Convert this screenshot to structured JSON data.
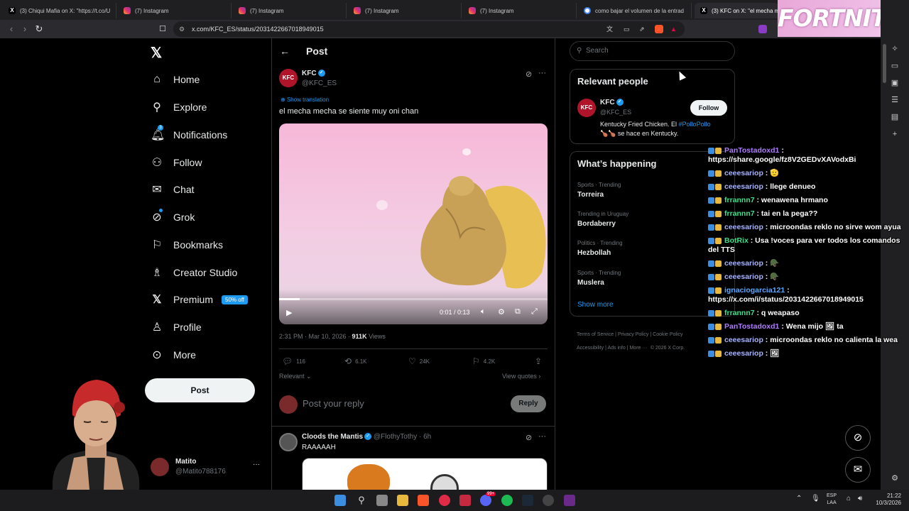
{
  "browser": {
    "tabs": [
      {
        "title": "(3) Chiqui Mafia on X: \"https://t.co/U",
        "icon": "x-icon"
      },
      {
        "title": "(7) Instagram",
        "icon": "instagram-icon"
      },
      {
        "title": "(7) Instagram",
        "icon": "instagram-icon"
      },
      {
        "title": "(7) Instagram",
        "icon": "instagram-icon"
      },
      {
        "title": "(7) Instagram",
        "icon": "instagram-icon"
      },
      {
        "title": "como bajar el volumen de la entrad",
        "icon": "google-icon"
      },
      {
        "title": "(3) KFC on X: \"el mecha m",
        "icon": "x-icon"
      }
    ],
    "url": "x.com/KFC_ES/status/2031422667018949015",
    "overlay_banner": "FORTNITE"
  },
  "sidebar": {
    "items": [
      {
        "label": "Home",
        "icon": "home-icon"
      },
      {
        "label": "Explore",
        "icon": "search-icon"
      },
      {
        "label": "Notifications",
        "icon": "bell-icon",
        "badge": "3"
      },
      {
        "label": "Follow",
        "icon": "add-person-icon"
      },
      {
        "label": "Chat",
        "icon": "mail-icon"
      },
      {
        "label": "Grok",
        "icon": "grok-icon"
      },
      {
        "label": "Bookmarks",
        "icon": "bookmark-icon"
      },
      {
        "label": "Creator Studio",
        "icon": "creator-icon"
      },
      {
        "label": "Premium",
        "icon": "x-icon",
        "badge": "50% off"
      },
      {
        "label": "Profile",
        "icon": "person-icon"
      },
      {
        "label": "More",
        "icon": "more-icon"
      }
    ],
    "post_button": "Post",
    "account": {
      "name": "Matito",
      "handle": "@Matito788176"
    }
  },
  "post": {
    "header": "Post",
    "author": {
      "name": "KFC",
      "handle": "@KFC_ES"
    },
    "show_translation": "Show translation",
    "text": "el mecha mecha se siente muy oni chan",
    "video": {
      "time": "0:01 / 0:13",
      "progress": 0.077
    },
    "meta": {
      "time": "2:31 PM · Mar 10, 2026 · ",
      "views_count": "911K",
      "views_label": " Views"
    },
    "stats": {
      "replies": "116",
      "reposts": "6.1K",
      "likes": "24K",
      "bookmarks": "4.2K"
    },
    "relevant": "Relevant",
    "view_quotes": "View quotes",
    "reply_placeholder": "Post your reply",
    "reply_button": "Reply"
  },
  "reply": {
    "name": "Cloods the Mantis",
    "handle": "@FlothyTothy",
    "age": "· 6h",
    "text": "RAAAAAH"
  },
  "right": {
    "search_placeholder": "Search",
    "relevant_people": {
      "title": "Relevant people",
      "name": "KFC",
      "handle": "@KFC_ES",
      "follow": "Follow",
      "bio_pre": "Kentucky Fried Chicken. El ",
      "bio_tag": "#PolloPollo",
      "bio_post": " se hace en Kentucky."
    },
    "happening": {
      "title": "What’s happening",
      "trends": [
        {
          "category": "Sports · Trending",
          "name": "Torreira"
        },
        {
          "category": "Trending in Uruguay",
          "name": "Bordaberry"
        },
        {
          "category": "Politics · Trending",
          "name": "Hezbollah"
        },
        {
          "category": "Sports · Trending",
          "name": "Muslera"
        }
      ],
      "show_more": "Show more"
    },
    "footer": [
      "Terms of Service",
      "Privacy Policy",
      "Cookie Policy",
      "Accessibility",
      "Ads info",
      "More ···",
      "© 2026 X Corp."
    ]
  },
  "chat": [
    {
      "user": "PanTostadoxd1",
      "color": "#b07cff",
      "text": ": https://share.google/fz8V2GEDvXAVodxBi"
    },
    {
      "user": "ceeesariop",
      "color": "#a7b3ff",
      "text": ": 🫡"
    },
    {
      "user": "ceeesariop",
      "color": "#a7b3ff",
      "text": ": llege denueo"
    },
    {
      "user": "frrannn7",
      "color": "#3ee08a",
      "text": ": wenawena hrmano"
    },
    {
      "user": "frrannn7",
      "color": "#3ee08a",
      "text": ": tai en la pega??"
    },
    {
      "user": "ceeesariop",
      "color": "#a7b3ff",
      "text": ": microondas reklo no sirve wom ayua"
    },
    {
      "user": "BotRix",
      "color": "#3ee08a",
      "text": ": Usa !voces para ver todos los comandos del TTS"
    },
    {
      "user": "ceeesariop",
      "color": "#a7b3ff",
      "text": ": 🪖"
    },
    {
      "user": "ceeesariop",
      "color": "#a7b3ff",
      "text": ": 🪖"
    },
    {
      "user": "ignaciogarcia121",
      "color": "#5aa9ff",
      "text": ": https://x.com/i/status/2031422667018949015"
    },
    {
      "user": "frrannn7",
      "color": "#3ee08a",
      "text": ": q weapaso"
    },
    {
      "user": "PanTostadoxd1",
      "color": "#b07cff",
      "text": ": Wena mijo 🖼 ta"
    },
    {
      "user": "ceeesariop",
      "color": "#a7b3ff",
      "text": ": microondas reklo no calienta la wea"
    },
    {
      "user": "ceeesariop",
      "color": "#a7b3ff",
      "text": ": 🖼"
    }
  ],
  "taskbar": {
    "lang": "ESP",
    "lang2": "LAA",
    "time": "21:22",
    "date": "10/3/2026",
    "discord_badge": "99+"
  },
  "colors": {
    "accent": "#1d9bf0",
    "background": "#000000",
    "border": "#2f3336",
    "muted": "#71767b"
  }
}
